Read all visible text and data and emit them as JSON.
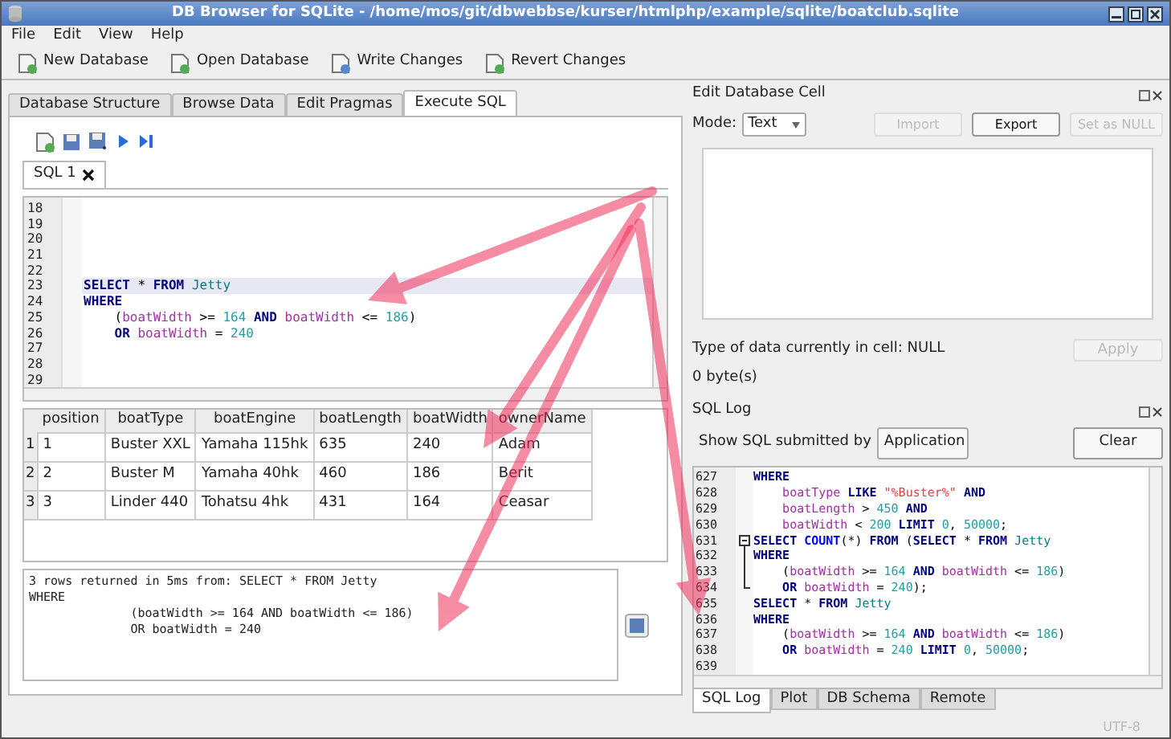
{
  "window": {
    "title": "DB Browser for SQLite - /home/mos/git/dbwebbse/kurser/htmlphp/example/sqlite/boatclub.sqlite"
  },
  "menu": [
    "File",
    "Edit",
    "View",
    "Help"
  ],
  "toolbar": [
    "New Database",
    "Open Database",
    "Write Changes",
    "Revert Changes"
  ],
  "tabs": [
    {
      "label": "Database Structure",
      "selected": false
    },
    {
      "label": "Browse Data",
      "selected": false
    },
    {
      "label": "Edit Pragmas",
      "selected": false
    },
    {
      "label": "Execute SQL",
      "selected": true
    }
  ],
  "sql_tabs": [
    {
      "label": "SQL 1",
      "selected": true
    }
  ],
  "editor": {
    "lines": [
      {
        "no": "18",
        "highlighted": false
      },
      {
        "no": "19",
        "highlighted": false
      },
      {
        "no": "20",
        "highlighted": false
      },
      {
        "no": "21",
        "highlighted": false
      },
      {
        "no": "22",
        "highlighted": false
      },
      {
        "no": "23",
        "highlighted": true,
        "tokens": [
          {
            "kind": "keyword",
            "text": "SELECT"
          },
          {
            "kind": "operator",
            "text": " * "
          },
          {
            "kind": "keyword",
            "text": "FROM"
          },
          {
            "kind": "table",
            "text": " Jetty"
          }
        ]
      },
      {
        "no": "24",
        "highlighted": false,
        "tokens": [
          {
            "kind": "keyword",
            "text": "WHERE"
          }
        ]
      },
      {
        "no": "25",
        "highlighted": false,
        "tokens": [
          {
            "kind": "operator",
            "text": "    ("
          },
          {
            "kind": "identifier",
            "text": "boatWidth"
          },
          {
            "kind": "operator",
            "text": " >= "
          },
          {
            "kind": "number",
            "text": "164"
          },
          {
            "kind": "keyword",
            "text": " AND"
          },
          {
            "kind": "identifier",
            "text": " boatWidth"
          },
          {
            "kind": "operator",
            "text": " <= "
          },
          {
            "kind": "number",
            "text": "186"
          },
          {
            "kind": "operator",
            "text": ")"
          }
        ]
      },
      {
        "no": "26",
        "highlighted": false,
        "tokens": [
          {
            "kind": "keyword",
            "text": "    OR"
          },
          {
            "kind": "identifier",
            "text": " boatWidth"
          },
          {
            "kind": "operator",
            "text": " = "
          },
          {
            "kind": "number",
            "text": "240"
          }
        ]
      },
      {
        "no": "27",
        "highlighted": false
      },
      {
        "no": "28",
        "highlighted": false
      },
      {
        "no": "29",
        "highlighted": false
      }
    ]
  },
  "results": {
    "columns": [
      "position",
      "boatType",
      "boatEngine",
      "boatLength",
      "boatWidth",
      "ownerName"
    ],
    "rows": [
      {
        "header": "1",
        "cells": [
          "1",
          "Buster XXL",
          "Yamaha 115hk",
          "635",
          "240",
          "Adam"
        ]
      },
      {
        "header": "2",
        "cells": [
          "2",
          "Buster M",
          "Yamaha 40hk",
          "460",
          "186",
          "Berit"
        ]
      },
      {
        "header": "3",
        "cells": [
          "3",
          "Linder 440",
          "Tohatsu 4hk",
          "431",
          "164",
          "Ceasar"
        ]
      }
    ]
  },
  "message": "3 rows returned in 5ms from: SELECT * FROM Jetty\nWHERE\n              (boatWidth >= 164 AND boatWidth <= 186)\n              OR boatWidth = 240",
  "edit_cell": {
    "title": "Edit Database Cell",
    "mode_label": "Mode:",
    "mode": "Text",
    "buttons": [
      {
        "label": "Import",
        "disabled": true
      },
      {
        "label": "Export",
        "disabled": false
      },
      {
        "label": "Set as NULL",
        "disabled": true
      }
    ],
    "type_info": "Type of data currently in cell: NULL",
    "size": "0 byte(s)",
    "apply": {
      "label": "Apply",
      "disabled": true
    }
  },
  "sql_log": {
    "title": "SQL Log",
    "filter_label": "Show SQL submitted by",
    "filter": "Application",
    "clear": "Clear",
    "lines": [
      {
        "no": "627",
        "kind": "plain",
        "tokens": [
          {
            "kind": "keyword",
            "text": "WHERE"
          }
        ]
      },
      {
        "no": "628",
        "kind": "plain",
        "tokens": [
          {
            "kind": "identifier",
            "text": "    boatType"
          },
          {
            "kind": "keyword",
            "text": " LIKE"
          },
          {
            "kind": "string",
            "text": " \"%Buster%\""
          },
          {
            "kind": "keyword",
            "text": " AND"
          }
        ]
      },
      {
        "no": "629",
        "kind": "plain",
        "tokens": [
          {
            "kind": "identifier",
            "text": "    boatLength"
          },
          {
            "kind": "operator",
            "text": " > "
          },
          {
            "kind": "number",
            "text": "450"
          },
          {
            "kind": "keyword",
            "text": " AND"
          }
        ]
      },
      {
        "no": "630",
        "kind": "plain",
        "tokens": [
          {
            "kind": "identifier",
            "text": "    boatWidth"
          },
          {
            "kind": "operator",
            "text": " < "
          },
          {
            "kind": "number",
            "text": "200"
          },
          {
            "kind": "keyword",
            "text": " LIMIT"
          },
          {
            "kind": "number",
            "text": " 0"
          },
          {
            "kind": "operator",
            "text": ", "
          },
          {
            "kind": "number",
            "text": "50000"
          },
          {
            "kind": "operator",
            "text": ";"
          }
        ]
      },
      {
        "no": "631",
        "kind": "foldstart",
        "tokens": [
          {
            "kind": "keyword",
            "text": "SELECT"
          },
          {
            "kind": "function",
            "text": " COUNT"
          },
          {
            "kind": "operator",
            "text": "(*) "
          },
          {
            "kind": "keyword",
            "text": "FROM"
          },
          {
            "kind": "operator",
            "text": " ("
          },
          {
            "kind": "keyword",
            "text": "SELECT"
          },
          {
            "kind": "operator",
            "text": " * "
          },
          {
            "kind": "keyword",
            "text": "FROM"
          },
          {
            "kind": "table",
            "text": " Jetty"
          }
        ]
      },
      {
        "no": "632",
        "kind": "foldbody",
        "tokens": [
          {
            "kind": "keyword",
            "text": "WHERE"
          }
        ]
      },
      {
        "no": "633",
        "kind": "foldbody",
        "tokens": [
          {
            "kind": "operator",
            "text": "    ("
          },
          {
            "kind": "identifier",
            "text": "boatWidth"
          },
          {
            "kind": "operator",
            "text": " >= "
          },
          {
            "kind": "number",
            "text": "164"
          },
          {
            "kind": "keyword",
            "text": " AND"
          },
          {
            "kind": "identifier",
            "text": " boatWidth"
          },
          {
            "kind": "operator",
            "text": " <= "
          },
          {
            "kind": "number",
            "text": "186"
          },
          {
            "kind": "operator",
            "text": ")"
          }
        ]
      },
      {
        "no": "634",
        "kind": "foldend",
        "tokens": [
          {
            "kind": "keyword",
            "text": "    OR"
          },
          {
            "kind": "identifier",
            "text": " boatWidth"
          },
          {
            "kind": "operator",
            "text": " = "
          },
          {
            "kind": "number",
            "text": "240"
          },
          {
            "kind": "operator",
            "text": ");"
          }
        ]
      },
      {
        "no": "635",
        "kind": "plain",
        "tokens": [
          {
            "kind": "keyword",
            "text": "SELECT"
          },
          {
            "kind": "operator",
            "text": " * "
          },
          {
            "kind": "keyword",
            "text": "FROM"
          },
          {
            "kind": "table",
            "text": " Jetty"
          }
        ]
      },
      {
        "no": "636",
        "kind": "plain",
        "tokens": [
          {
            "kind": "keyword",
            "text": "WHERE"
          }
        ]
      },
      {
        "no": "637",
        "kind": "plain",
        "tokens": [
          {
            "kind": "operator",
            "text": "    ("
          },
          {
            "kind": "identifier",
            "text": "boatWidth"
          },
          {
            "kind": "operator",
            "text": " >= "
          },
          {
            "kind": "number",
            "text": "164"
          },
          {
            "kind": "keyword",
            "text": " AND"
          },
          {
            "kind": "identifier",
            "text": " boatWidth"
          },
          {
            "kind": "operator",
            "text": " <= "
          },
          {
            "kind": "number",
            "text": "186"
          },
          {
            "kind": "operator",
            "text": ")"
          }
        ]
      },
      {
        "no": "638",
        "kind": "plain",
        "tokens": [
          {
            "kind": "keyword",
            "text": "    OR"
          },
          {
            "kind": "identifier",
            "text": " boatWidth"
          },
          {
            "kind": "operator",
            "text": " = "
          },
          {
            "kind": "number",
            "text": "240"
          },
          {
            "kind": "keyword",
            "text": " LIMIT"
          },
          {
            "kind": "number",
            "text": " 0"
          },
          {
            "kind": "operator",
            "text": ", "
          },
          {
            "kind": "number",
            "text": "50000"
          },
          {
            "kind": "operator",
            "text": ";"
          }
        ]
      },
      {
        "no": "639",
        "kind": "plain"
      }
    ]
  },
  "bottom_tabs": [
    {
      "label": "SQL Log",
      "selected": true
    },
    {
      "label": "Plot",
      "selected": false
    },
    {
      "label": "DB Schema",
      "selected": false
    },
    {
      "label": "Remote",
      "selected": false
    }
  ],
  "status_bar": {
    "encoding": "UTF-8"
  }
}
